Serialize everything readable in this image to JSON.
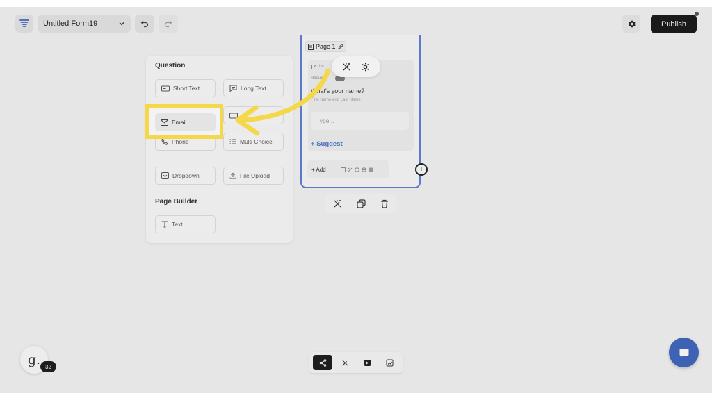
{
  "header": {
    "form_name": "Untitled Form19",
    "publish_label": "Publish"
  },
  "panel": {
    "question_heading": "Question",
    "page_builder_heading": "Page Builder",
    "question_items": [
      {
        "label": "Short Text",
        "icon": "short-text-icon"
      },
      {
        "label": "Long Text",
        "icon": "long-text-icon"
      },
      {
        "label": "Email",
        "icon": "mail-icon"
      },
      {
        "label": "",
        "icon": "number-icon"
      },
      {
        "label": "Phone",
        "icon": "phone-icon"
      },
      {
        "label": "Multi Choice",
        "icon": "list-icon"
      },
      {
        "label": "Dropdown",
        "icon": "dropdown-icon"
      },
      {
        "label": "File Upload",
        "icon": "upload-icon"
      }
    ],
    "page_builder_items": [
      {
        "label": "Text",
        "icon": "text-icon"
      }
    ]
  },
  "page": {
    "title": "Page 1",
    "question": {
      "tag_label": "Im",
      "required_label": "Required",
      "title": "What's your name?",
      "subtitle": "First Name and Last Name",
      "input_placeholder": "Type...",
      "suggest_label": "+ Suggest"
    },
    "add_label": "+ Add"
  },
  "avatar": {
    "letter": "g.",
    "badge_count": "32"
  },
  "colors": {
    "highlight": "#f5d84a",
    "arrow": "#f5d84a",
    "page_border": "#5c79c9",
    "suggest": "#4a6fc0",
    "chat": "#3e62b4",
    "publish_bg": "#1a1a1a"
  }
}
